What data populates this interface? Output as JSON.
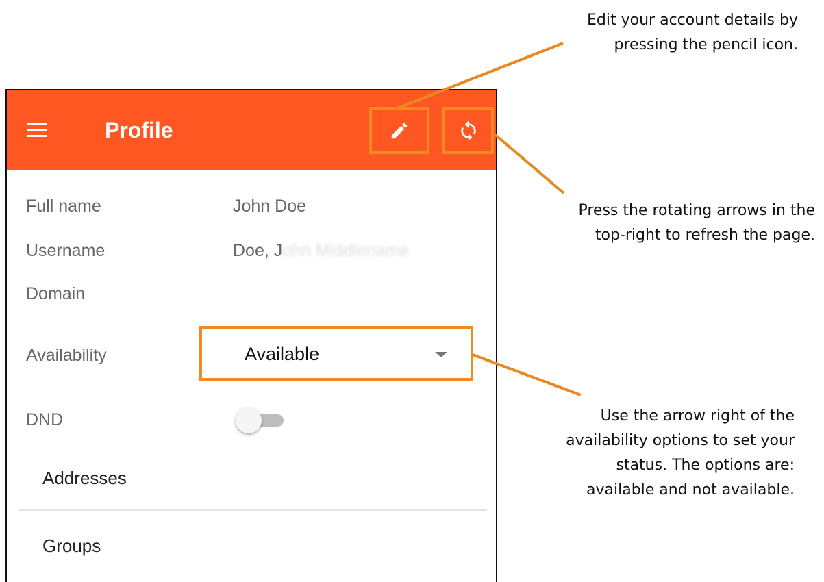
{
  "app": {
    "title": "Profile"
  },
  "profile": {
    "full_name_label": "Full name",
    "full_name_value": "John Doe",
    "username_label": "Username",
    "username_value": "Doe, J",
    "username_blurred_tail": "ohn Middlename",
    "domain_label": "Domain",
    "availability_label": "Availability",
    "availability_value": "Available",
    "dnd_label": "DND",
    "dnd_enabled": false
  },
  "sections": {
    "addresses_label": "Addresses",
    "groups_label": "Groups"
  },
  "callouts": {
    "edit_line1": "Edit your account details by",
    "edit_line2": "pressing the pencil icon.",
    "refresh_line1": "Press the rotating arrows in the",
    "refresh_line2": "top-right to refresh the page.",
    "availability_line1": "Use the arrow right of the",
    "availability_line2": "availability options to set your",
    "availability_line3": "status. The options are:",
    "availability_line4": "available and not available."
  },
  "colors": {
    "appbar": "#ff5722",
    "highlight": "#f08a24",
    "callout_line": "#e8891f"
  },
  "icons": {
    "menu": "menu-icon",
    "edit": "pencil-icon",
    "refresh": "refresh-icon",
    "dropdown": "chevron-down-icon"
  }
}
